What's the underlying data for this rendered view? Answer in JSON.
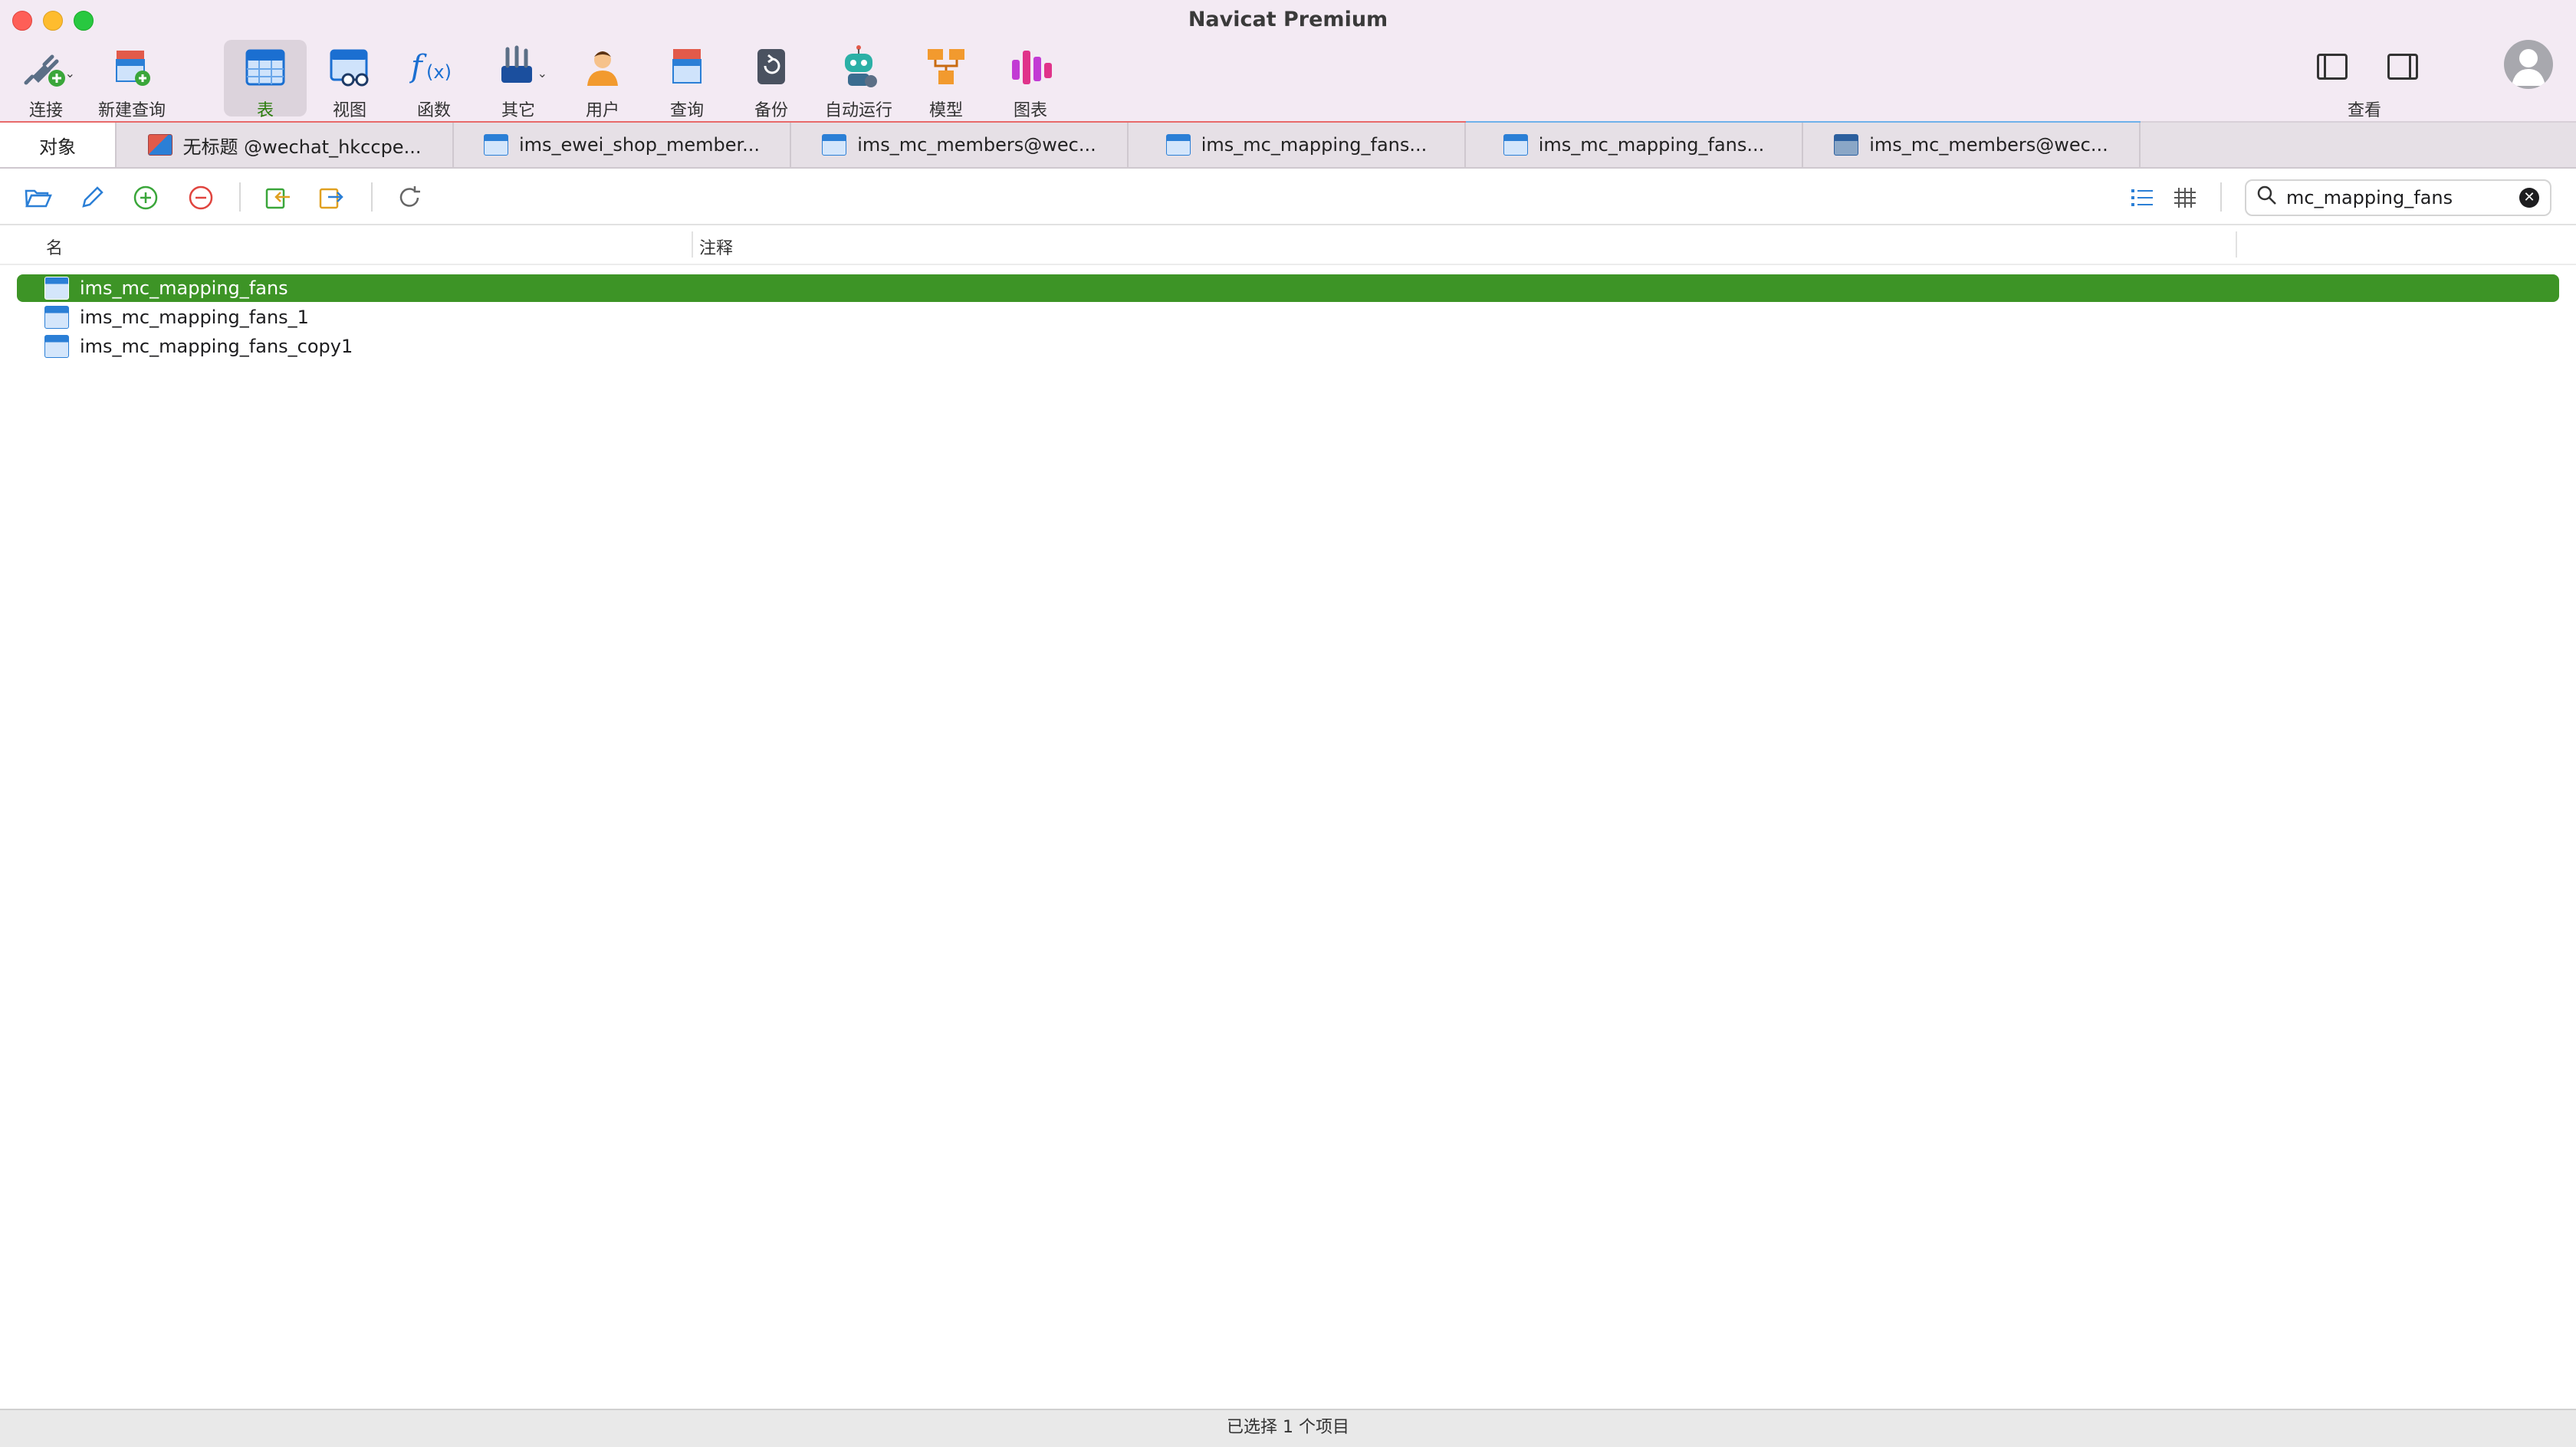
{
  "window": {
    "title": "Navicat Premium"
  },
  "toolbar": {
    "connect": "连接",
    "new_query": "新建查询",
    "table": "表",
    "view": "视图",
    "function": "函数",
    "other": "其它",
    "user": "用户",
    "query": "查询",
    "backup": "备份",
    "automation": "自动运行",
    "model": "模型",
    "chart": "图表",
    "view_menu": "查看"
  },
  "tabs": [
    {
      "label": "对象"
    },
    {
      "label": "无标题 @wechat_hkccpe..."
    },
    {
      "label": "ims_ewei_shop_member..."
    },
    {
      "label": "ims_mc_members@wec..."
    },
    {
      "label": "ims_mc_mapping_fans..."
    },
    {
      "label": "ims_mc_mapping_fans..."
    },
    {
      "label": "ims_mc_members@wec..."
    }
  ],
  "search": {
    "value": "mc_mapping_fans"
  },
  "list": {
    "columns": {
      "name": "名",
      "comment": "注释"
    },
    "rows": [
      {
        "name": "ims_mc_mapping_fans",
        "selected": true
      },
      {
        "name": "ims_mc_mapping_fans_1",
        "selected": false
      },
      {
        "name": "ims_mc_mapping_fans_copy1",
        "selected": false
      }
    ]
  },
  "status": {
    "text": "已选择 1 个项目"
  },
  "colors": {
    "accent": "#3d9426",
    "tab_indicator_red": "#e86a6a",
    "tab_indicator_blue": "#6fb1ea"
  }
}
